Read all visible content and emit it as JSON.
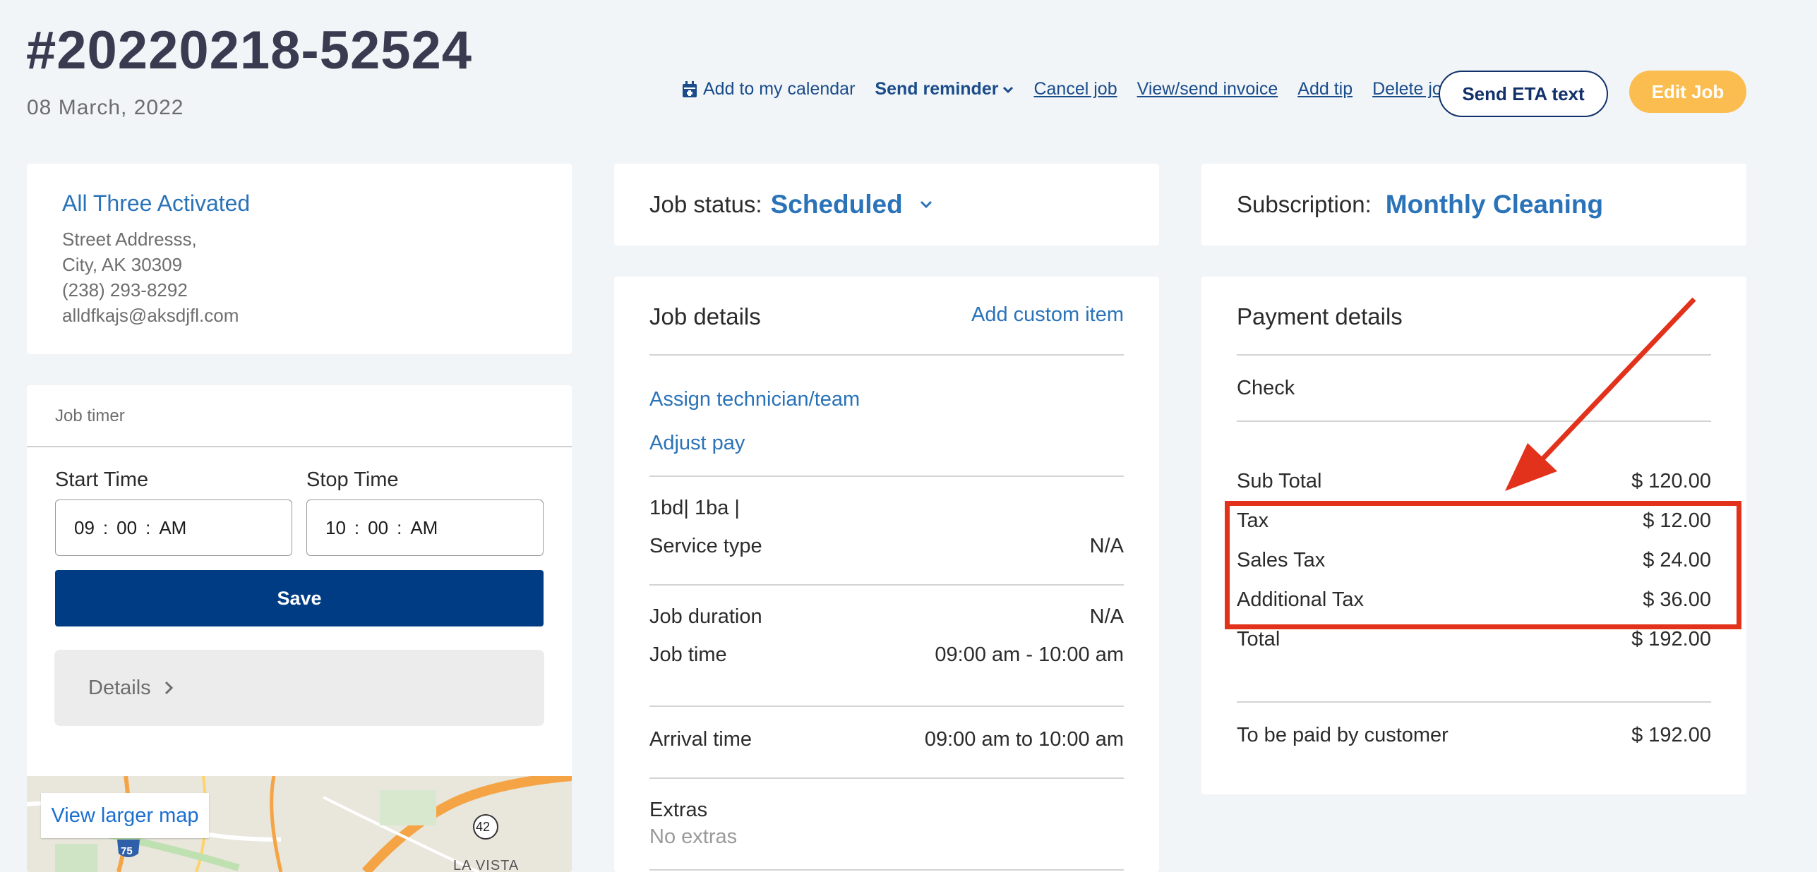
{
  "header": {
    "job_number": "#20220218-52524",
    "date": "08 March, 2022",
    "actions": {
      "add_calendar": "Add to my calendar",
      "send_reminder": "Send reminder",
      "cancel_job": "Cancel job",
      "view_invoice": "View/send invoice",
      "add_tip": "Add tip",
      "delete_job": "Delete job"
    },
    "send_eta": "Send ETA text",
    "edit_job": "Edit Job"
  },
  "customer": {
    "name": "All Three Activated",
    "street": "Street Addresss,",
    "city": "City, AK 30309",
    "phone": "(238) 293-8292",
    "email": "alldfkajs@aksdjfl.com"
  },
  "timer": {
    "title": "Job timer",
    "start_label": "Start Time",
    "stop_label": "Stop Time",
    "start": {
      "h": "09",
      "m": "00",
      "ampm": "AM"
    },
    "stop": {
      "h": "10",
      "m": "00",
      "ampm": "AM"
    },
    "save": "Save",
    "details": "Details"
  },
  "map": {
    "link": "View larger map",
    "place": "LA VISTA",
    "route_a": "75",
    "route_b": "42"
  },
  "job_status": {
    "label": "Job status:",
    "value": "Scheduled"
  },
  "job_details": {
    "title": "Job details",
    "add_custom": "Add custom item",
    "assign": "Assign technician/team",
    "adjust_pay": "Adjust pay",
    "rooms": "1bd| 1ba |",
    "service_type_label": "Service type",
    "service_type_value": "N/A",
    "duration_label": "Job duration",
    "duration_value": "N/A",
    "time_label": "Job time",
    "time_value": "09:00 am - 10:00 am",
    "arrival_label": "Arrival time",
    "arrival_value": "09:00 am to 10:00 am",
    "extras_label": "Extras",
    "extras_value": "No extras"
  },
  "subscription": {
    "label": "Subscription:",
    "value": "Monthly Cleaning"
  },
  "payment": {
    "title": "Payment details",
    "method": "Check",
    "rows": [
      {
        "label": "Sub Total",
        "value": "$ 120.00"
      },
      {
        "label": "Tax",
        "value": "$ 12.00"
      },
      {
        "label": "Sales Tax",
        "value": "$ 24.00"
      },
      {
        "label": "Additional Tax",
        "value": "$ 36.00"
      },
      {
        "label": "Total",
        "value": "$ 192.00"
      }
    ],
    "to_be_paid_label": "To be paid by customer",
    "to_be_paid_value": "$ 192.00"
  },
  "colors": {
    "accent_blue": "#2a73b8",
    "navy": "#003c83",
    "edit_yellow": "#fbbd4f",
    "highlight_red": "#e3321b"
  }
}
